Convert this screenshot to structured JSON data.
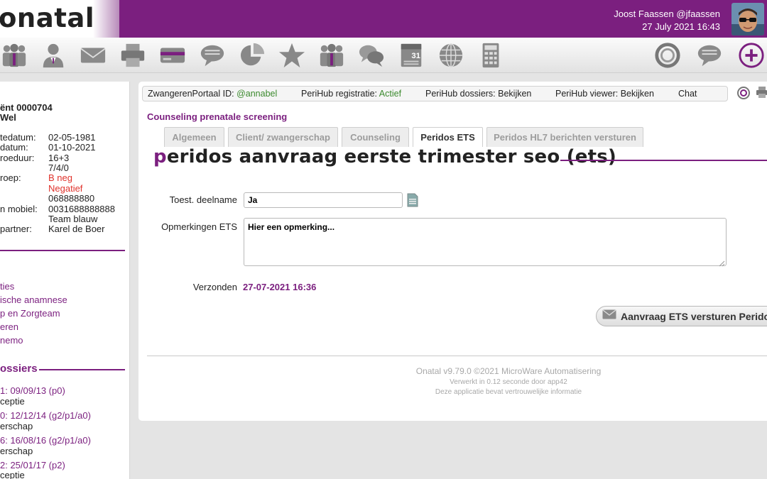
{
  "header": {
    "logo_text": "onatal",
    "user_name": "Joost Faassen @jfaassen",
    "date_time": "27 July 2021 16:43",
    "accent_color": "#7b1f7f"
  },
  "toolbar": {
    "icons": [
      "users-icon",
      "doctor-icon",
      "mail-icon",
      "printer-icon",
      "card-icon",
      "speech-bubble-icon",
      "pie-chart-icon",
      "star-icon",
      "group-icon",
      "chat-bubbles-icon",
      "calendar-icon",
      "globe-icon",
      "calculator-icon",
      "ring-icon",
      "message-icon",
      "plus-icon"
    ],
    "calendar_day": "31"
  },
  "sidebar": {
    "client_label": "ënt",
    "client_number": "0000704",
    "client_name": "Wel",
    "fields": [
      {
        "label": "tedatum:",
        "value": "02-05-1981"
      },
      {
        "label": "datum:",
        "value": "01-10-2021"
      },
      {
        "label": "roeduur:",
        "value": "16+3"
      },
      {
        "label": "",
        "value": "7/4/0"
      },
      {
        "label": "roep:",
        "value": "B neg"
      },
      {
        "label": "",
        "value": "Negatief"
      },
      {
        "label": "",
        "value": "068888880"
      },
      {
        "label": "n mobiel:",
        "value": "0031688888888"
      },
      {
        "label": "",
        "value": "Team blauw"
      },
      {
        "label": "partner:",
        "value": "Karel de Boer"
      }
    ],
    "links": [
      "ties",
      "ische anamnese",
      "p en Zorgteam",
      "eren",
      "nemo"
    ],
    "dossiers_heading": "ossiers",
    "dossiers": [
      {
        "title": "1: 09/09/13 (p0)",
        "sub": "ceptie"
      },
      {
        "title": "0: 12/12/14 (g2/p1/a0)",
        "sub": "erschap"
      },
      {
        "title": "6: 16/08/16 (g2/p1/a0)",
        "sub": "erschap"
      },
      {
        "title": "2: 25/01/17 (p2)",
        "sub": "ceptie"
      }
    ]
  },
  "topbar": {
    "portal_label": "ZwangerenPortaal ID:",
    "portal_value": "@annabel",
    "registratie_label": "PeriHub registratie:",
    "registratie_value": "Actief",
    "dossiers_label": "PeriHub dossiers:",
    "dossiers_value": "Bekijken",
    "viewer_label": "PeriHub viewer:",
    "viewer_value": "Bekijken",
    "chat_label": "Chat"
  },
  "main": {
    "section_title": "Counseling prenatale screening",
    "tabs": [
      {
        "label": "Algemeen",
        "active": false
      },
      {
        "label": "Client/ zwangerschap",
        "active": false
      },
      {
        "label": "Counseling",
        "active": false
      },
      {
        "label": "Peridos ETS",
        "active": true
      },
      {
        "label": "Peridos HL7 berichten versturen",
        "active": false
      }
    ],
    "form_title_first": "p",
    "form_title_rest": "eridos aanvraag eerste trimester seo (ets)",
    "deelname_label": "Toest. deelname",
    "deelname_value": "Ja",
    "opmerkingen_label": "Opmerkingen ETS",
    "opmerkingen_value": "Hier een opmerking...",
    "verzonden_label": "Verzonden",
    "verzonden_value": "27-07-2021 16:36",
    "send_button_label": "Aanvraag ETS versturen Peridos"
  },
  "footer": {
    "version": "Onatal v9.79.0 ©2021 MicroWare Automatisering",
    "processed": "Verwerkt in 0.12 seconde door app42",
    "confidential": "Deze applicatie bevat vertrouwelijke informatie"
  }
}
